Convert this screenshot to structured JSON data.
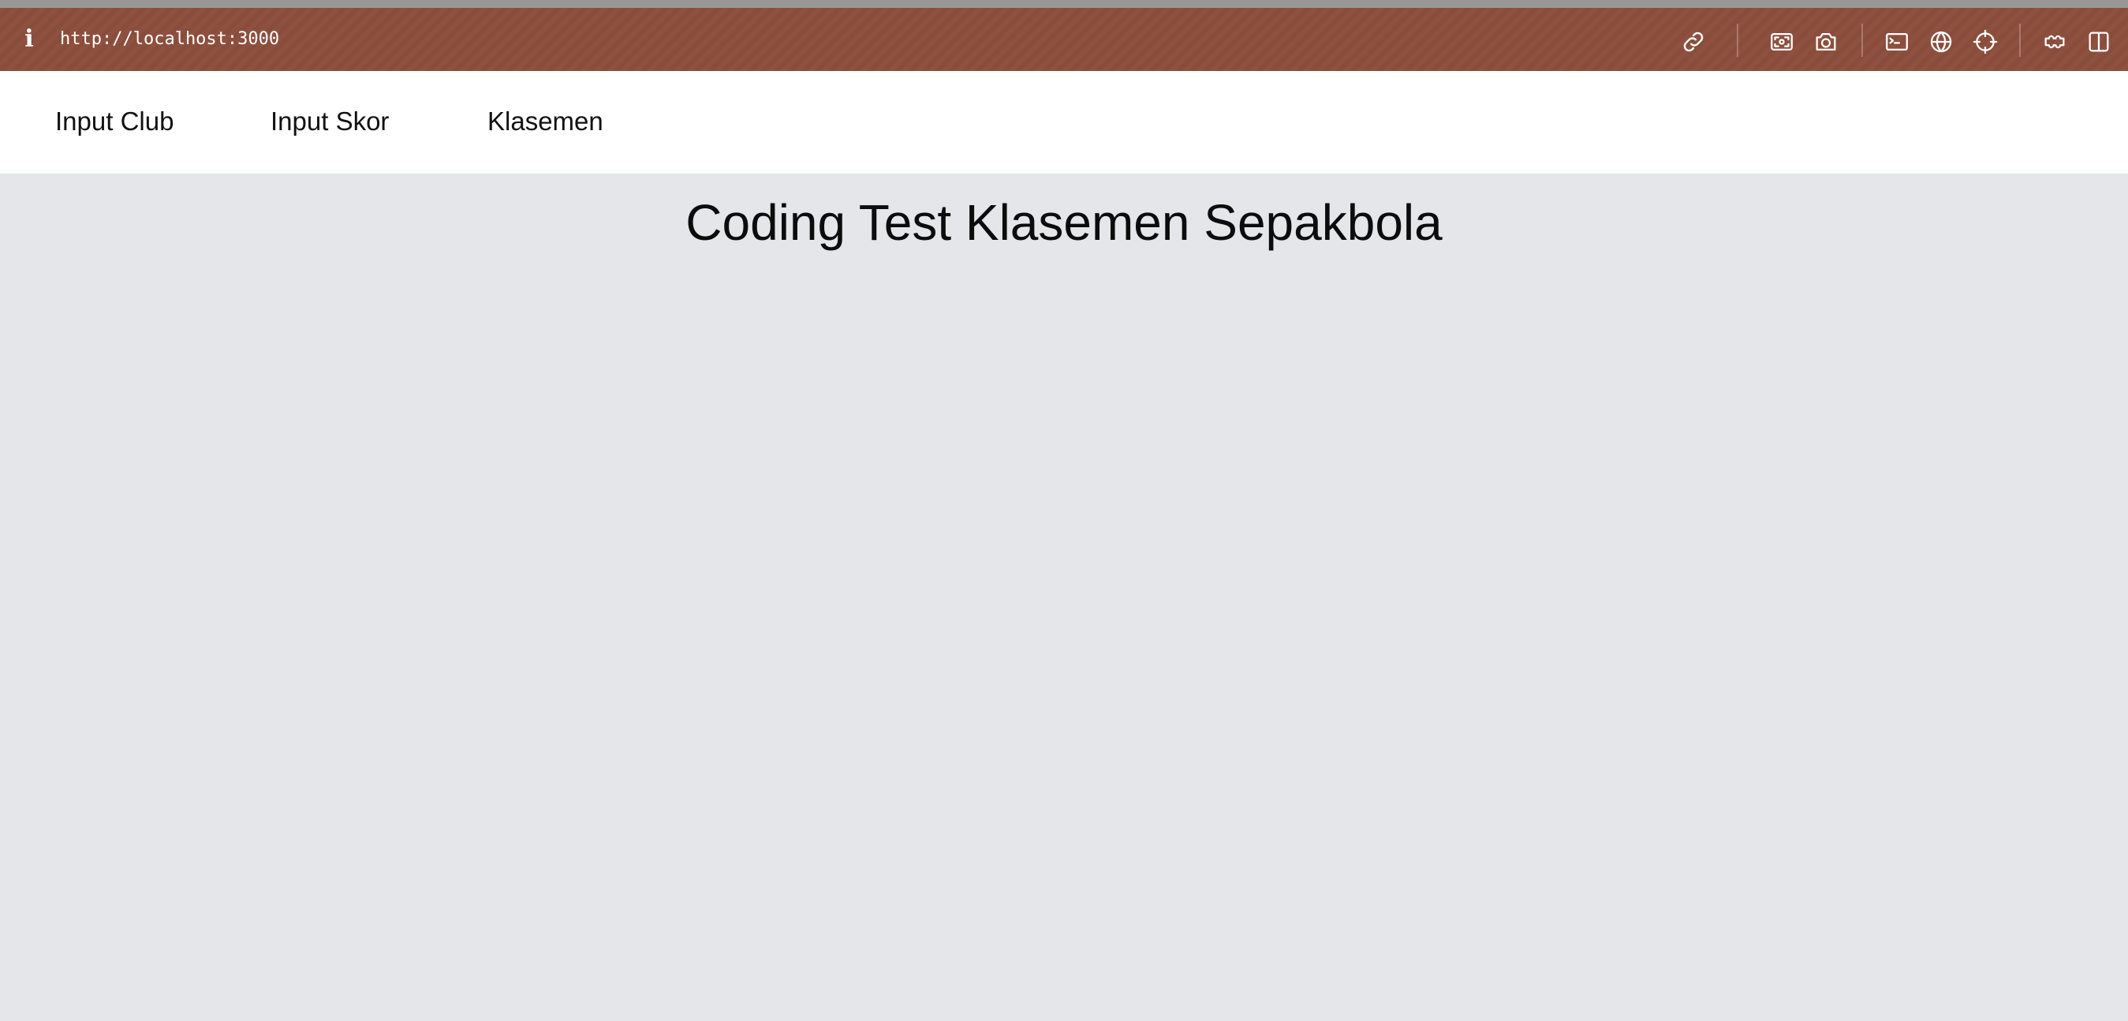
{
  "browser": {
    "url": "http://localhost:3000",
    "info_icon": "i",
    "toolbar_icons": [
      "link-icon",
      "screenshot-area-icon",
      "camera-icon",
      "terminal-icon",
      "globe-icon",
      "crosshair-icon",
      "extensions-icon",
      "split-view-icon"
    ],
    "bar_color": "#8e5140"
  },
  "nav": {
    "items": [
      {
        "label": "Input Club"
      },
      {
        "label": "Input Skor"
      },
      {
        "label": "Klasemen"
      }
    ]
  },
  "main": {
    "title": "Coding Test Klasemen Sepakbola",
    "background": "#e5e6ea"
  }
}
